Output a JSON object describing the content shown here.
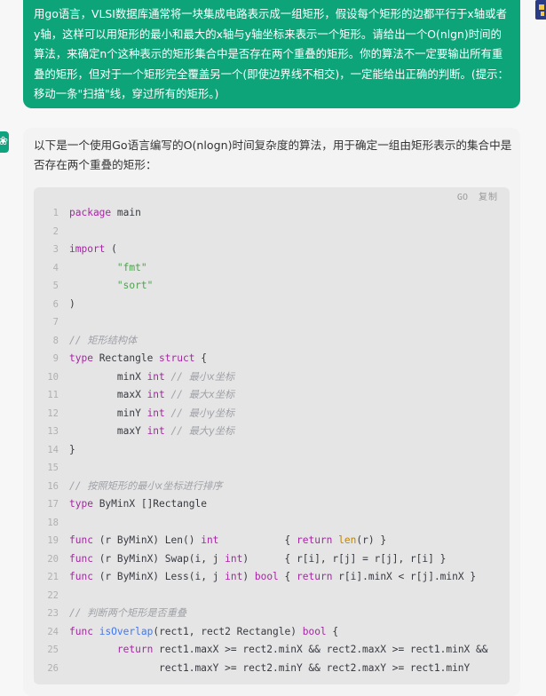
{
  "user_message": {
    "text": "用go语言，VLSI数据库通常将一块集成电路表示成一组矩形，假设每个矩形的边都平行于x轴或者y轴，这样可以用矩形的最小和最大的x轴与y轴坐标来表示一个矩形。请给出一个O(nlgn)时间的算法，来确定n个这种表示的矩形集合中是否存在两个重叠的矩形。你的算法不一定要输出所有重叠的矩形，但对于一个矩形完全覆盖另一个(即使边界线不相交)，一定能给出正确的判断。(提示：移动一条\"扫描\"线，穿过所有的矩形。)"
  },
  "assistant": {
    "avatar_glyph": "❀",
    "intro": "以下是一个使用Go语言编写的O(nlogn)时间复杂度的算法，用于确定一组由矩形表示的集合中是否存在两个重叠的矩形：",
    "code": {
      "language": "GO",
      "copy_label": "复制",
      "lines": [
        {
          "n": "1",
          "t": [
            [
              "kw",
              "package"
            ],
            [
              "id",
              " main"
            ]
          ]
        },
        {
          "n": "2",
          "t": []
        },
        {
          "n": "3",
          "t": [
            [
              "kw",
              "import"
            ],
            [
              "id",
              " ("
            ]
          ]
        },
        {
          "n": "4",
          "t": [
            [
              "id",
              "        "
            ],
            [
              "str",
              "\"fmt\""
            ]
          ]
        },
        {
          "n": "5",
          "t": [
            [
              "id",
              "        "
            ],
            [
              "str",
              "\"sort\""
            ]
          ]
        },
        {
          "n": "6",
          "t": [
            [
              "id",
              ")"
            ]
          ]
        },
        {
          "n": "7",
          "t": []
        },
        {
          "n": "8",
          "t": [
            [
              "cmt",
              "// 矩形结构体"
            ]
          ]
        },
        {
          "n": "9",
          "t": [
            [
              "kw",
              "type"
            ],
            [
              "id",
              " Rectangle "
            ],
            [
              "kw",
              "struct"
            ],
            [
              "id",
              " {"
            ]
          ]
        },
        {
          "n": "10",
          "t": [
            [
              "id",
              "        minX "
            ],
            [
              "kw",
              "int"
            ],
            [
              "cmt",
              " // 最小x坐标"
            ]
          ]
        },
        {
          "n": "11",
          "t": [
            [
              "id",
              "        maxX "
            ],
            [
              "kw",
              "int"
            ],
            [
              "cmt",
              " // 最大x坐标"
            ]
          ]
        },
        {
          "n": "12",
          "t": [
            [
              "id",
              "        minY "
            ],
            [
              "kw",
              "int"
            ],
            [
              "cmt",
              " // 最小y坐标"
            ]
          ]
        },
        {
          "n": "13",
          "t": [
            [
              "id",
              "        maxY "
            ],
            [
              "kw",
              "int"
            ],
            [
              "cmt",
              " // 最大y坐标"
            ]
          ]
        },
        {
          "n": "14",
          "t": [
            [
              "id",
              "}"
            ]
          ]
        },
        {
          "n": "15",
          "t": []
        },
        {
          "n": "16",
          "t": [
            [
              "cmt",
              "// 按照矩形的最小x坐标进行排序"
            ]
          ]
        },
        {
          "n": "17",
          "t": [
            [
              "kw",
              "type"
            ],
            [
              "id",
              " ByMinX []Rectangle"
            ]
          ]
        },
        {
          "n": "18",
          "t": []
        },
        {
          "n": "19",
          "t": [
            [
              "kw",
              "func"
            ],
            [
              "id",
              " (r ByMinX) Len() "
            ],
            [
              "kw",
              "int"
            ],
            [
              "id",
              "           { "
            ],
            [
              "kw",
              "return"
            ],
            [
              "id",
              " "
            ],
            [
              "bi",
              "len"
            ],
            [
              "id",
              "(r) }"
            ]
          ]
        },
        {
          "n": "20",
          "t": [
            [
              "kw",
              "func"
            ],
            [
              "id",
              " (r ByMinX) Swap(i, j "
            ],
            [
              "kw",
              "int"
            ],
            [
              "id",
              ")      { r[i], r[j] = r[j], r[i] }"
            ]
          ]
        },
        {
          "n": "21",
          "t": [
            [
              "kw",
              "func"
            ],
            [
              "id",
              " (r ByMinX) Less(i, j "
            ],
            [
              "kw",
              "int"
            ],
            [
              "id",
              ") "
            ],
            [
              "kw",
              "bool"
            ],
            [
              "id",
              " { "
            ],
            [
              "kw",
              "return"
            ],
            [
              "id",
              " r[i].minX < r[j].minX }"
            ]
          ]
        },
        {
          "n": "22",
          "t": []
        },
        {
          "n": "23",
          "t": [
            [
              "cmt",
              "// 判断两个矩形是否重叠"
            ]
          ]
        },
        {
          "n": "24",
          "t": [
            [
              "kw",
              "func"
            ],
            [
              "id",
              " "
            ],
            [
              "fn",
              "isOverlap"
            ],
            [
              "id",
              "(rect1, rect2 Rectangle) "
            ],
            [
              "kw",
              "bool"
            ],
            [
              "id",
              " {"
            ]
          ]
        },
        {
          "n": "25",
          "t": [
            [
              "id",
              "        "
            ],
            [
              "kw",
              "return"
            ],
            [
              "id",
              " rect1.maxX >= rect2.minX && rect2.maxX >= rect1.minX &&"
            ]
          ]
        },
        {
          "n": "26",
          "t": [
            [
              "id",
              "               rect1.maxY >= rect2.minY && rect2.maxY >= rect1.minY"
            ]
          ]
        }
      ]
    }
  }
}
